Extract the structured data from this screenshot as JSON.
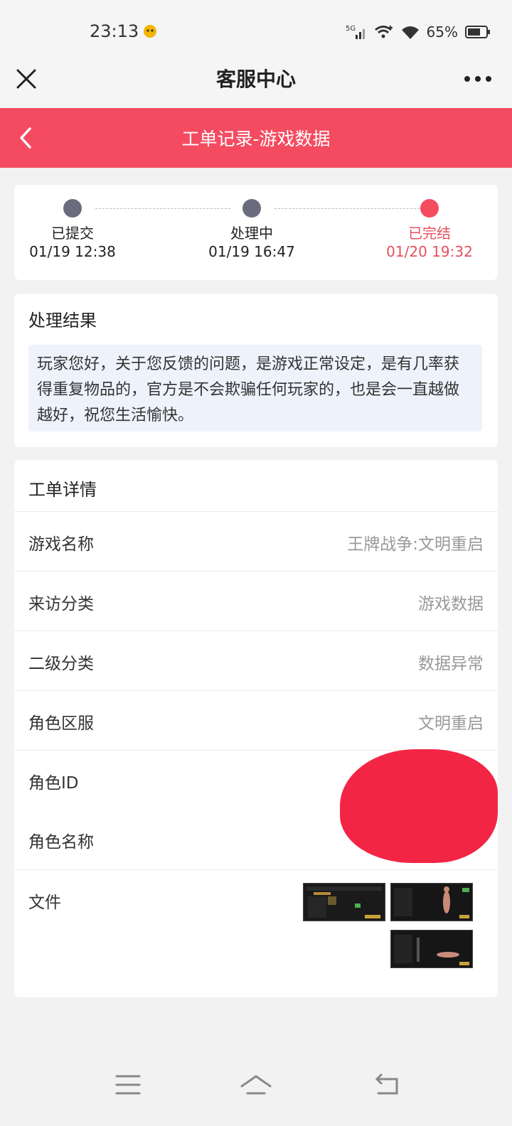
{
  "status_bar": {
    "time": "23:13",
    "network": "5G",
    "battery": "65%"
  },
  "title_bar": {
    "title": "客服中心"
  },
  "header": {
    "title": "工单记录-游戏数据"
  },
  "progress": {
    "steps": [
      {
        "label": "已提交",
        "time": "01/19 12:38"
      },
      {
        "label": "处理中",
        "time": "01/19 16:47"
      },
      {
        "label": "已完结",
        "time": "01/20 19:32"
      }
    ]
  },
  "result": {
    "heading": "处理结果",
    "text": "玩家您好，关于您反馈的问题，是游戏正常设定，是有几率获得重复物品的，官方是不会欺骗任何玩家的，也是会一直越做越好，祝您生活愉快。"
  },
  "details": {
    "heading": "工单详情",
    "rows": [
      {
        "key": "游戏名称",
        "value": "王牌战争:文明重启"
      },
      {
        "key": "来访分类",
        "value": "游戏数据"
      },
      {
        "key": "二级分类",
        "value": "数据异常"
      },
      {
        "key": "角色区服",
        "value": "文明重启"
      },
      {
        "key": "角色ID",
        "value": ""
      },
      {
        "key": "角色名称",
        "value": ""
      },
      {
        "key": "文件",
        "value": ""
      }
    ]
  },
  "colors": {
    "accent": "#f44b61",
    "done_text": "#e5505e",
    "pending_dot": "#6b6b80"
  }
}
